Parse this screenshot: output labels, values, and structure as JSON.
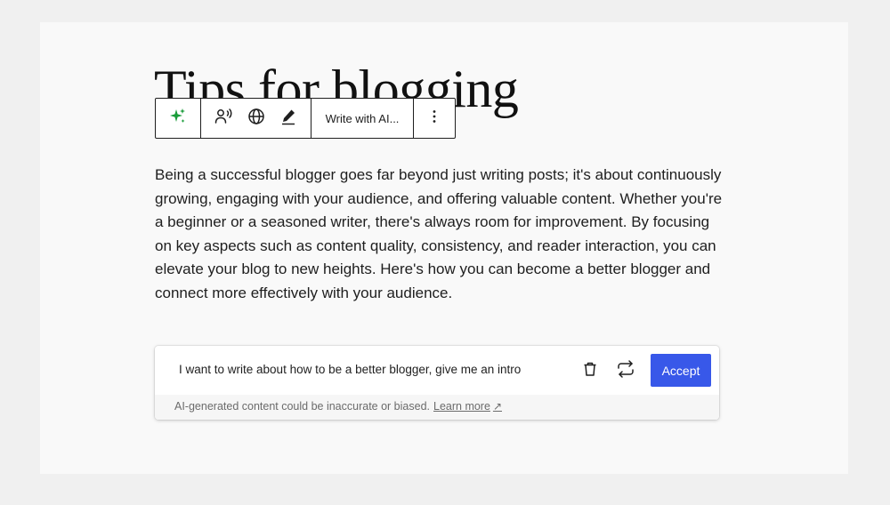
{
  "post": {
    "title": "Tips for blogging",
    "paragraph": "Being a successful blogger goes far beyond just writing posts; it's about continuously growing, engaging with your audience, and offering valuable content. Whether you're a beginner or a seasoned writer, there's always room for improvement. By focusing on key aspects such as content quality, consistency, and reader interaction, you can elevate your blog to new heights. Here's how you can become a better blogger and connect more effectively with your audience."
  },
  "toolbar": {
    "ai_icon": "sparkles-icon",
    "speech_icon": "text-to-speech-icon",
    "language_icon": "globe-icon",
    "edit_icon": "pencil-icon",
    "write_with_ai_label": "Write with AI...",
    "more_icon": "more-vertical-icon",
    "ai_icon_color": "#1a9c3a"
  },
  "ai_panel": {
    "prompt": "I want to write about how to be a better blogger, give me an intro",
    "delete_icon": "trash-icon",
    "regenerate_icon": "regenerate-icon",
    "accept_label": "Accept",
    "accent_color": "#3858e9",
    "disclaimer": "AI-generated content could be inaccurate or biased.",
    "learn_more_label": "Learn more",
    "learn_more_arrow": "↗"
  }
}
